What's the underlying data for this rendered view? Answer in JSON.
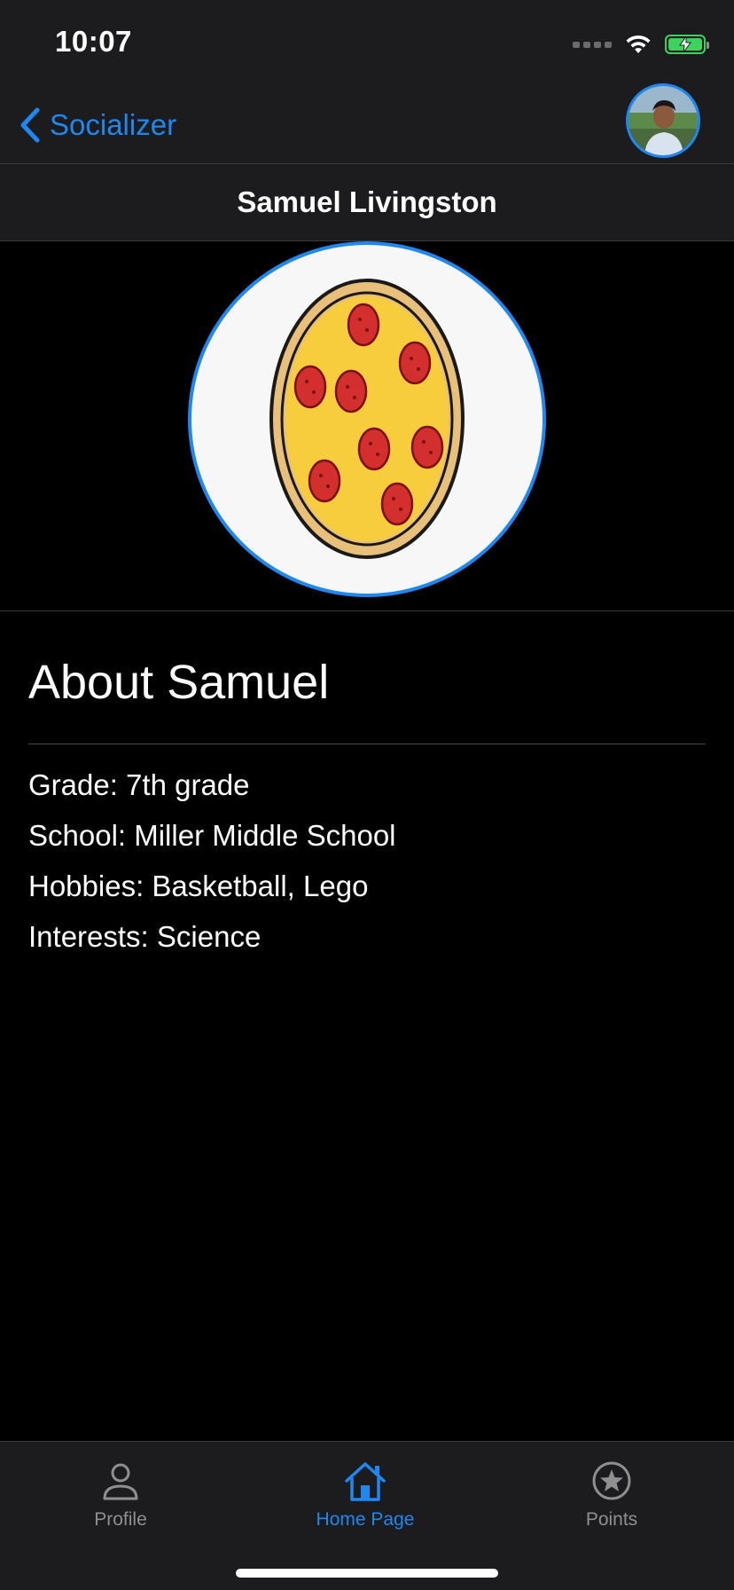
{
  "status_bar": {
    "time": "10:07",
    "icons": [
      "cellular-signal-icon",
      "wifi-icon",
      "battery-charging-icon"
    ]
  },
  "nav": {
    "back_label": "Socializer",
    "back_icon": "chevron-left-icon",
    "avatar_icon": "user-avatar"
  },
  "profile": {
    "name": "Samuel Livingston",
    "picture_icon": "pizza-image",
    "about_heading": "About Samuel",
    "details": [
      "Grade: 7th grade",
      "School: Miller Middle School",
      "Hobbies: Basketball, Lego",
      "Interests: Science"
    ]
  },
  "tab_bar": {
    "tabs": [
      {
        "label": "Profile",
        "icon": "person-icon",
        "active": false
      },
      {
        "label": "Home Page",
        "icon": "house-icon",
        "active": true
      },
      {
        "label": "Points",
        "icon": "star-circle-icon",
        "active": false
      }
    ]
  },
  "colors": {
    "accent": "#1e88f2",
    "background": "#000000",
    "bar_background": "#1c1c1e",
    "inactive_tab": "#8e8e93",
    "battery_green": "#3bd25d"
  }
}
